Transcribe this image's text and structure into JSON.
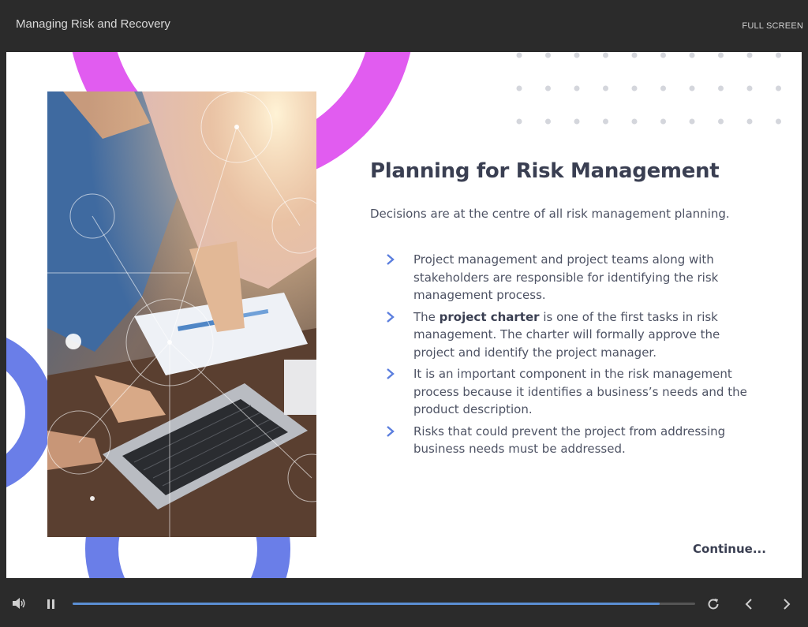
{
  "header": {
    "course_title": "Managing Risk and Recovery",
    "fullscreen_label": "FULL SCREEN"
  },
  "slide": {
    "heading": "Planning for Risk Management",
    "intro": "Decisions are at the centre of all risk management planning.",
    "bullets": [
      {
        "text": "Project management and project teams along with stakeholders are responsible for identifying the risk management process."
      },
      {
        "prefix": "The ",
        "bold": "project charter",
        "suffix": " is one of the first tasks in risk management. The charter will formally approve the project and identify the project manager."
      },
      {
        "text": "It is an important component in the risk management process because it identifies a business’s needs and the product description."
      },
      {
        "text": "Risks that could prevent the project from addressing business needs must be addressed."
      }
    ],
    "continue_label": "Continue..."
  },
  "player": {
    "progress_fraction": 0.943,
    "icons": [
      "volume-icon",
      "pause-icon",
      "replay-icon",
      "previous-icon",
      "next-icon"
    ]
  },
  "colors": {
    "magenta_ring": "#e15cf0",
    "blue_ring": "#6a7ee8",
    "accent_chevron": "#5b7ede",
    "progress": "#5b8fd4",
    "chrome": "#2b2b2b"
  }
}
